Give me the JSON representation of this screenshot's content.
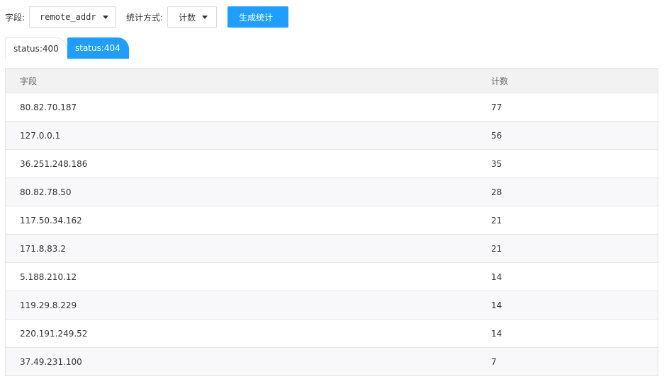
{
  "toolbar": {
    "field_label": "字段:",
    "field_value": "remote_addr",
    "method_label": "统计方式:",
    "method_value": "计数",
    "generate_label": "生成统计",
    "accent_color": "#1e9fff"
  },
  "tabs": [
    {
      "label": "status:400",
      "active": false
    },
    {
      "label": "status:404",
      "active": true
    }
  ],
  "table": {
    "headers": [
      "字段",
      "计数"
    ],
    "rows": [
      [
        "80.82.70.187",
        "77"
      ],
      [
        "127.0.0.1",
        "56"
      ],
      [
        "36.251.248.186",
        "35"
      ],
      [
        "80.82.78.50",
        "28"
      ],
      [
        "117.50.34.162",
        "21"
      ],
      [
        "171.8.83.2",
        "21"
      ],
      [
        "5.188.210.12",
        "14"
      ],
      [
        "119.29.8.229",
        "14"
      ],
      [
        "220.191.249.52",
        "14"
      ],
      [
        "37.49.231.100",
        "7"
      ]
    ]
  }
}
